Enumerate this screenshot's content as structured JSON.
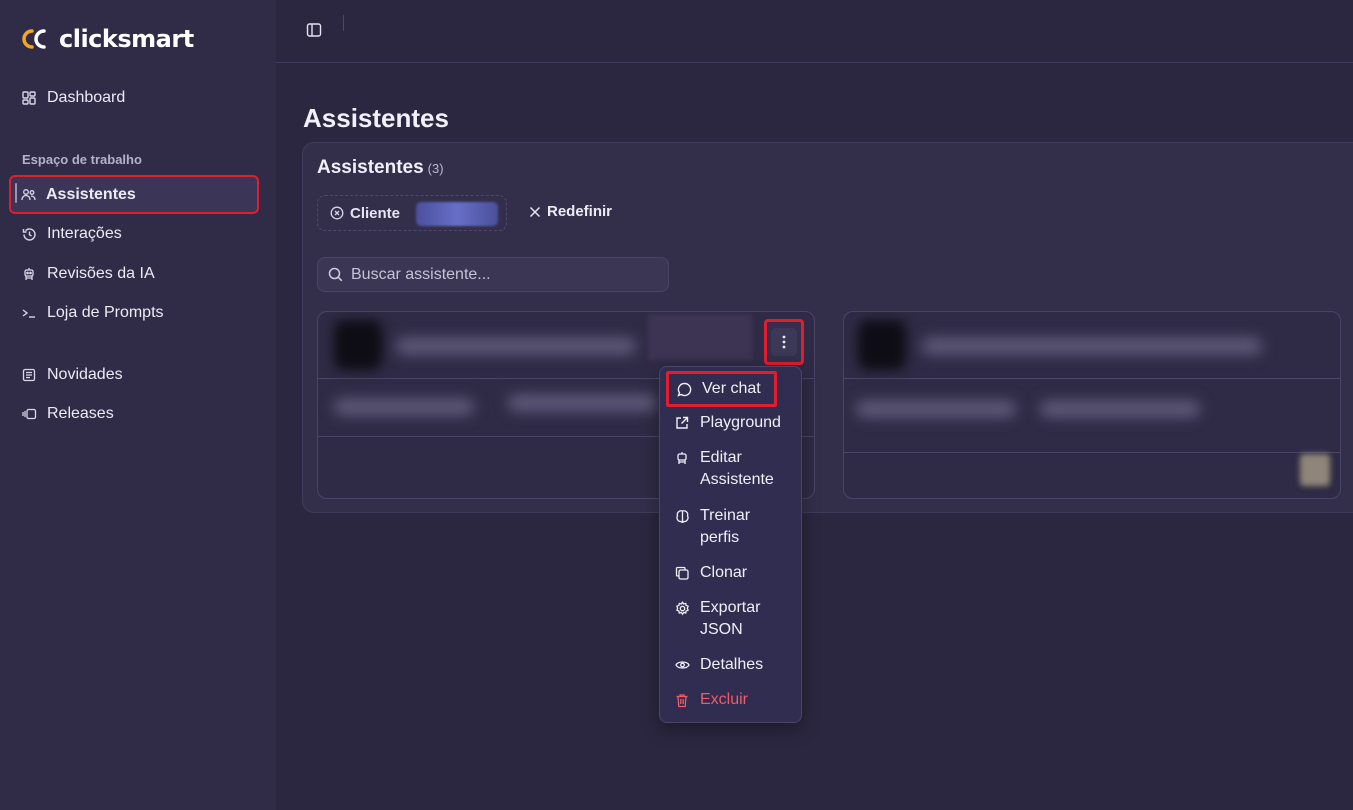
{
  "app": {
    "brand_prefix": "click",
    "brand_suffix": "smart",
    "brand_colors": {
      "accent": "#f5a623",
      "text": "#ffffff"
    }
  },
  "sidebar": {
    "dashboard": {
      "label": "Dashboard",
      "icon": "dashboard-icon"
    },
    "section_label": "Espaço de trabalho",
    "items": [
      {
        "label": "Assistentes",
        "icon": "users-icon",
        "active": true
      },
      {
        "label": "Interações",
        "icon": "history-icon"
      },
      {
        "label": "Revisões da IA",
        "icon": "robot-icon"
      },
      {
        "label": "Loja de Prompts",
        "icon": "terminal-icon"
      }
    ],
    "extra": [
      {
        "label": "Novidades",
        "icon": "newspaper-icon"
      },
      {
        "label": "Releases",
        "icon": "releases-icon"
      }
    ]
  },
  "main": {
    "page_title": "Assistentes",
    "panel": {
      "title": "Assistentes",
      "count": "(3)",
      "filter_label": "Cliente",
      "reset_label": "Redefinir",
      "search_placeholder": "Buscar assistente..."
    }
  },
  "menu": {
    "items": [
      {
        "label": "Ver chat",
        "icon": "chat-icon"
      },
      {
        "label": "Playground",
        "icon": "external-link-icon"
      },
      {
        "label": "Editar Assistente",
        "icon": "robot-icon"
      },
      {
        "label": "Treinar perfis",
        "icon": "brain-icon"
      },
      {
        "label": "Clonar",
        "icon": "copy-icon"
      },
      {
        "label": "Exportar JSON",
        "icon": "gear-icon"
      },
      {
        "label": "Detalhes",
        "icon": "eye-icon"
      },
      {
        "label": "Excluir",
        "icon": "trash-icon",
        "danger": true
      }
    ]
  },
  "colors": {
    "highlight": "#e11d2e",
    "danger": "#f05a6a",
    "sidebar_bg": "#302c48",
    "main_bg": "#2b2740"
  }
}
